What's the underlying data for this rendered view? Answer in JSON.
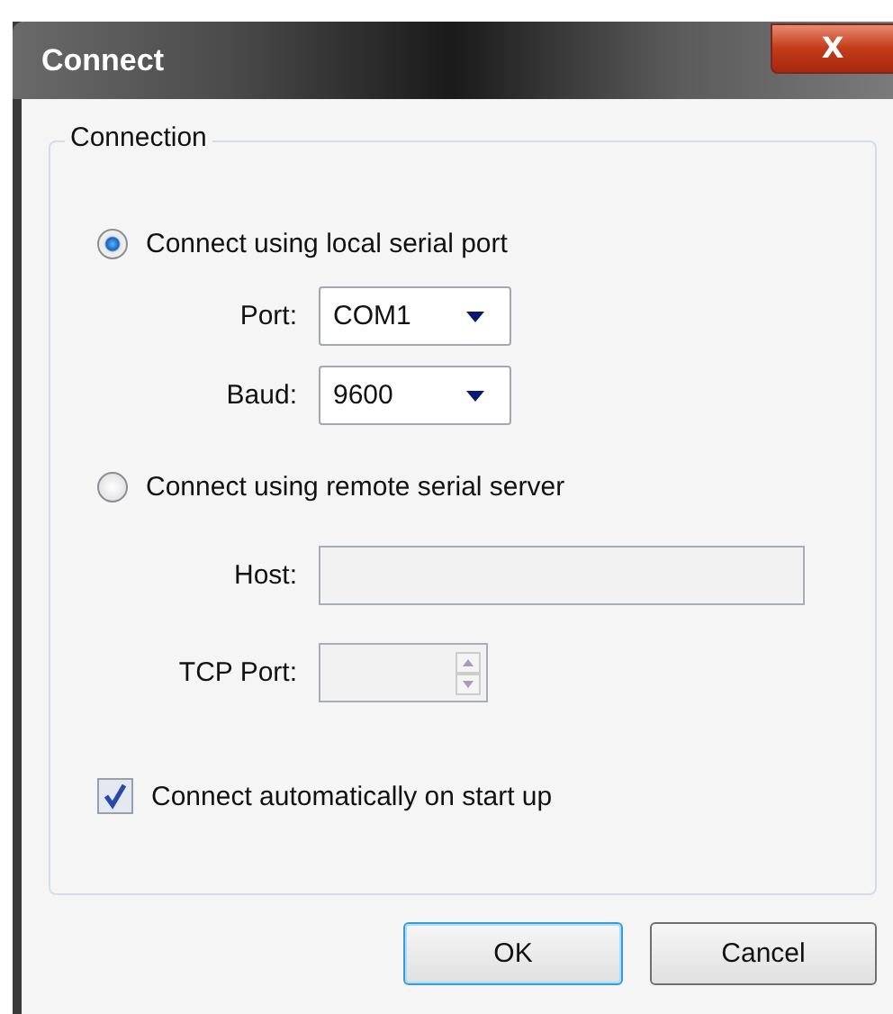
{
  "window": {
    "title": "Connect",
    "close_label": "X"
  },
  "group": {
    "title": "Connection"
  },
  "local_option": {
    "label": "Connect using local serial port",
    "selected": true
  },
  "local_fields": [
    {
      "label": "Port:",
      "value": "COM1"
    },
    {
      "label": "Baud:",
      "value": "9600"
    }
  ],
  "remote_option": {
    "label": "Connect using remote serial server",
    "selected": false
  },
  "remote_fields": [
    {
      "label": "Host:",
      "kind": "text",
      "disabled": true
    },
    {
      "label": "TCP Port:",
      "kind": "spinner",
      "disabled": true
    }
  ],
  "auto_connect": {
    "label": "Connect automatically on start up",
    "checked": true
  },
  "buttons": [
    {
      "label": "OK",
      "default": true
    },
    {
      "label": "Cancel",
      "default": false
    }
  ]
}
